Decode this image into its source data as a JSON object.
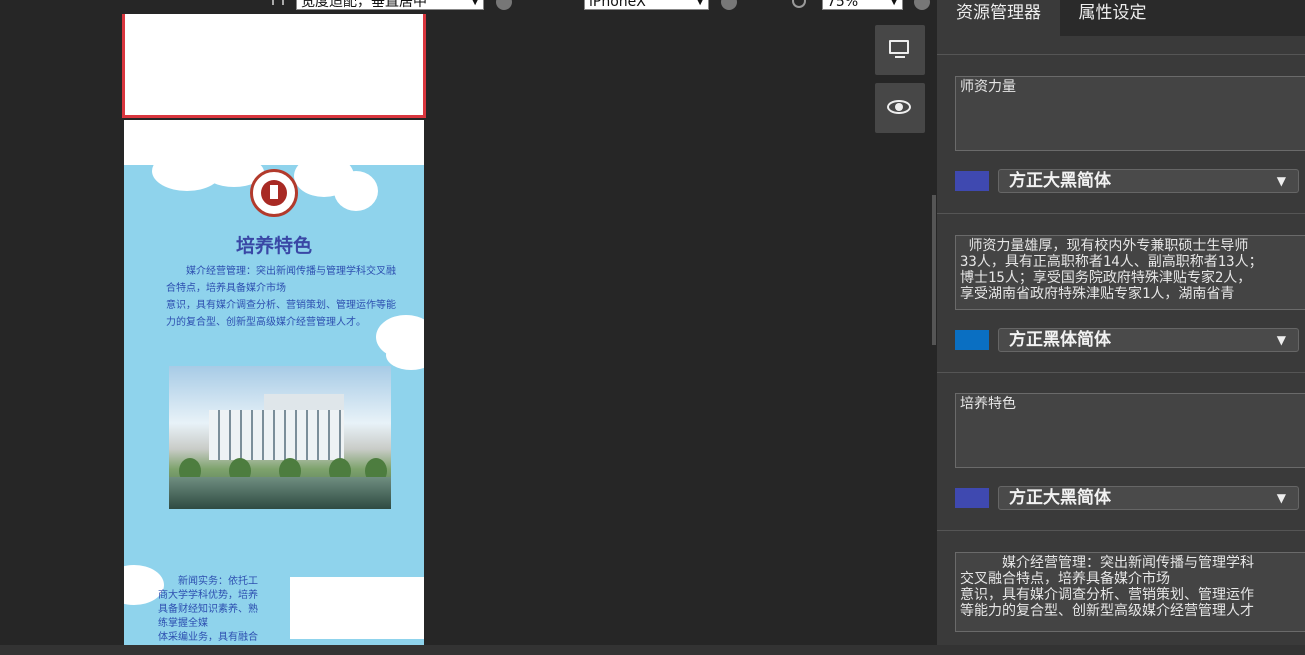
{
  "toolbar": {
    "layout_select": "宽度适配，垂直居中",
    "device_select": "iPhoneX",
    "zoom_select": "75%"
  },
  "preview": {
    "title": "培养特色",
    "paragraph": "　　媒介经营管理：突出新闻传播与管理学科交叉融合特点，培养具备媒介市场\n意识，具有媒介调查分析、营销策划、管理运作等能力的复合型、创新型高级媒介经营管理人才。",
    "bottom_text": "　　新闻实务：依托工\n商大学学科优势，培养\n具备财经知识素养、熟\n练掌握全媒\n体采编业务，具有融合"
  },
  "panel": {
    "tabs": [
      {
        "label": "资源管理器"
      },
      {
        "label": "属性设定"
      }
    ],
    "items": [
      {
        "text": "师资力量",
        "font": "方正大黑简体",
        "color": "#3f49b0"
      },
      {
        "text": " 师资力量雄厚，现有校内外专兼职硕士生导师\n33人，具有正高职称者14人、副高职称者13人；\n博士15人；享受国务院政府特殊津贴专家2人，\n享受湖南省政府特殊津贴专家1人，湖南省青",
        "font": "方正黑体简体",
        "color": "#0a6fc2"
      },
      {
        "text": "培养特色",
        "font": "方正大黑简体",
        "color": "#3f49b0"
      },
      {
        "text": "　　　媒介经营管理：突出新闻传播与管理学科\n交叉融合特点，培养具备媒介市场\n意识，具有媒介调查分析、营销策划、管理运作\n等能力的复合型、创新型高级媒介经营管理人才",
        "font": "",
        "color": ""
      }
    ]
  },
  "icons": {
    "monitor": "monitor-icon",
    "eye": "eye-icon",
    "dropdown": "chevron-down-icon"
  }
}
